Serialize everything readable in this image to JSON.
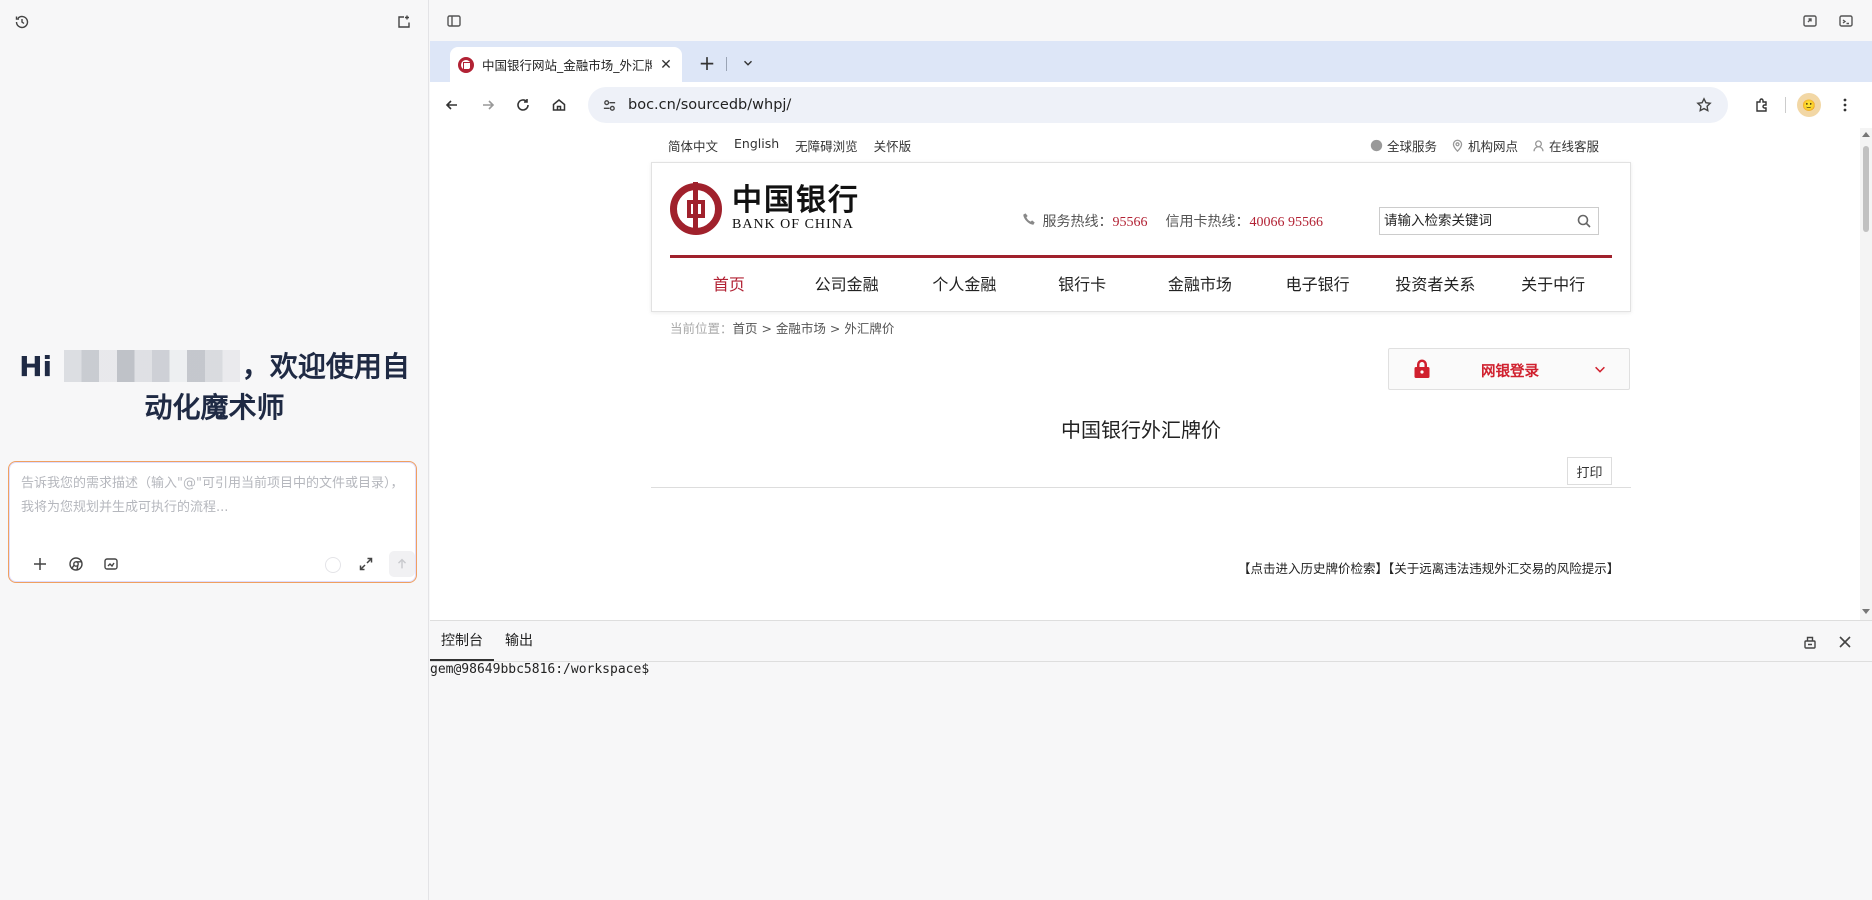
{
  "assistant": {
    "greeting_prefix": "Hi",
    "greeting_suffix": "，欢迎使用自动化魔术师",
    "prompt_placeholder": "告诉我您的需求描述（输入\"@\"可引用当前项目中的文件或目录），我将为您规划并生成可执行的流程..."
  },
  "browser": {
    "tab_title": "中国银行网站_金融市场_外汇牌价",
    "url": "boc.cn/sourcedb/whpj/"
  },
  "page": {
    "top_links": [
      "简体中文",
      "English",
      "无障碍浏览",
      "关怀版"
    ],
    "top_right": [
      "全球服务",
      "机构网点",
      "在线客服"
    ],
    "logo_cn": "中国银行",
    "logo_en": "BANK OF CHINA",
    "service_hotline_label": "服务热线：",
    "service_hotline_number": "95566",
    "card_hotline_label": "信用卡热线：",
    "card_hotline_number": "40066 95566",
    "search_placeholder": "请输入检索关键词",
    "nav": [
      "首页",
      "公司金融",
      "个人金融",
      "银行卡",
      "金融市场",
      "电子银行",
      "投资者关系",
      "关于中行"
    ],
    "breadcrumb_label": "当前位置：",
    "breadcrumb_path": "首页 > 金融市场 > 外汇牌价",
    "ebank_login": "网银登录",
    "title": "中国银行外汇牌价",
    "print": "打印",
    "history_link": "【点击进入历史牌价检索】",
    "risk_link": "【关于远离违法违规外汇交易的风险提示】"
  },
  "terminal": {
    "tabs": [
      "控制台",
      "输出"
    ],
    "prompt": "gem@98649bbc5816:/workspace$"
  },
  "colors": {
    "boc_red": "#a0212c",
    "accent_red": "#d0202e",
    "tabbar_bg": "#dde6f7"
  }
}
